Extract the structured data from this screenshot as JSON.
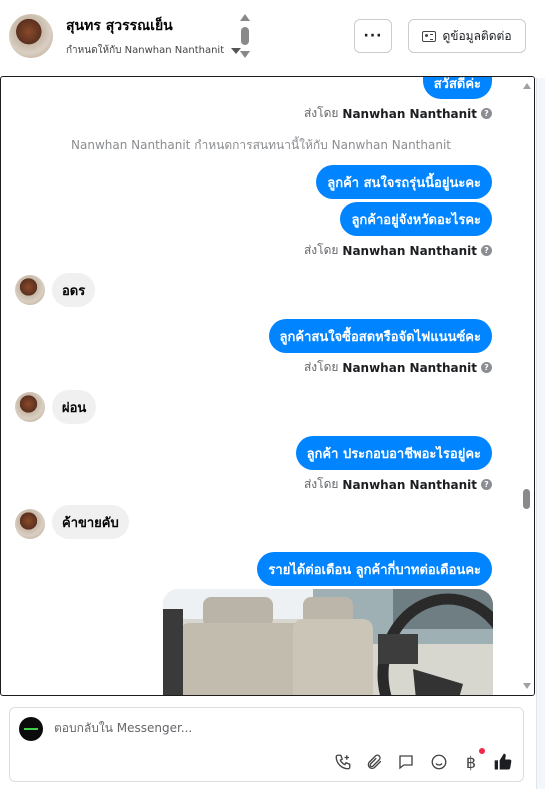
{
  "header": {
    "contact_name": "สุนทร สุวรรณเย็น",
    "assigned_to": "กำหนดให้กับ Nanwhan Nanthanit",
    "more_label": "···",
    "contact_info_label": "ดูข้อมูลติดต่อ"
  },
  "conversation": {
    "partial_top_message": "สวัสดีค่ะ",
    "system_message": "Nanwhan Nanthanit กำหนดการสนทนานี้ให้กับ Nanwhan Nanthanit",
    "sent_by_prefix": "ส่งโดย",
    "sent_by_name": "Nanwhan Nanthanit",
    "outgoing": [
      "ลูกค้า สนใจรถรุ่นนี้อยู่นะคะ",
      "ลูกค้าอยู่จังหวัดอะไรคะ",
      "ลูกค้าสนใจซื้อสดหรือจัดไฟแนนซ์คะ",
      "ลูกค้า ประกอบอาชีพอะไรอยู่คะ",
      "รายได้ต่อเดือน ลูกค้ากี่บาทต่อเดือนคะ"
    ],
    "incoming": [
      "อดร",
      "ผ่อน",
      "ค้าขายคับ"
    ]
  },
  "composer": {
    "placeholder": "ตอบกลับใน Messenger..."
  },
  "icons": {
    "call": "phone-plus-icon",
    "attach": "paperclip-icon",
    "saved_replies": "chat-bubble-icon",
    "emoji": "smiley-icon",
    "payment": "baht-icon",
    "like": "thumbs-up-icon"
  },
  "colors": {
    "outgoing_bubble": "#0084ff",
    "incoming_bubble": "#f0f0f0",
    "like": "#050505",
    "badge": "#f02849"
  }
}
